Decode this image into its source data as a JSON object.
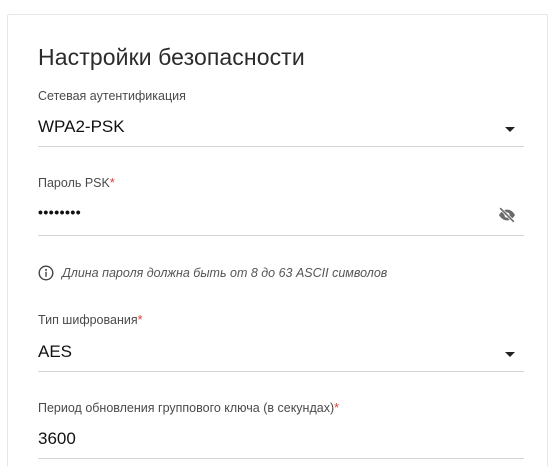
{
  "section": {
    "title": "Настройки безопасности"
  },
  "network_auth": {
    "label": "Сетевая аутентификация",
    "value": "WPA2-PSK",
    "icon": "chevron-down-icon"
  },
  "psk_password": {
    "label": "Пароль PSK",
    "required_mark": "*",
    "masked_value": "••••••••",
    "toggle_icon": "eye-off-icon"
  },
  "hint": {
    "icon": "info-icon",
    "text": "Длина пароля должна быть от 8 до 63 ASCII символов"
  },
  "encryption": {
    "label": "Тип шифрования",
    "required_mark": "*",
    "value": "AES",
    "icon": "chevron-down-icon"
  },
  "group_key_period": {
    "label": "Период обновления группового ключа (в секундах)",
    "required_mark": "*",
    "value": "3600"
  },
  "colors": {
    "required": "#e53935",
    "underline": "#d4d4d4",
    "text": "#222222"
  }
}
